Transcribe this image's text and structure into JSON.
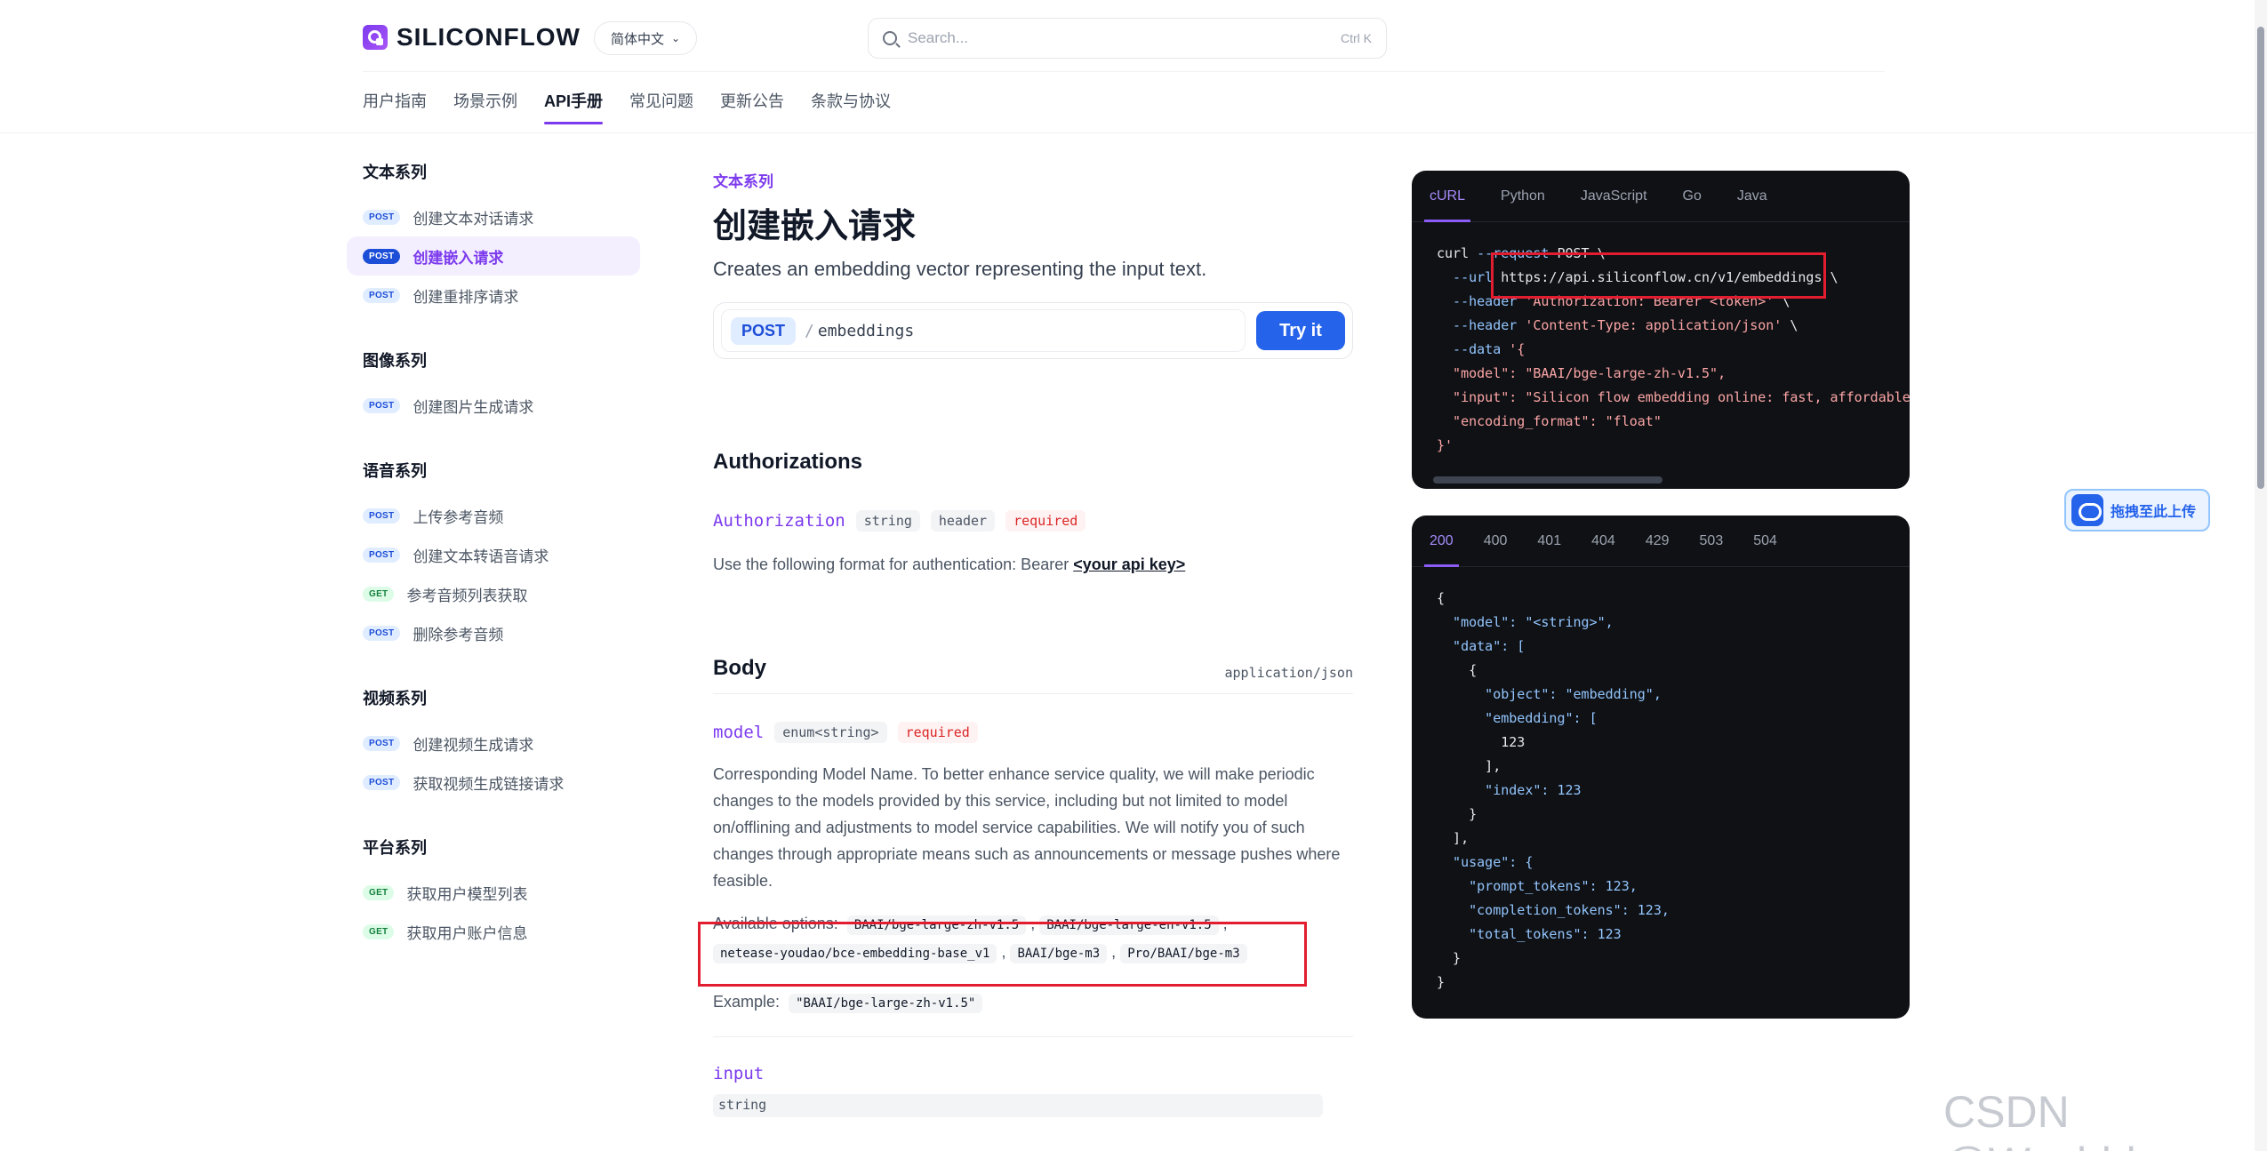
{
  "header": {
    "logo_text": "SILICONFLOW",
    "language": "简体中文",
    "search_placeholder": "Search...",
    "search_shortcut": "Ctrl K",
    "nav": [
      {
        "label": "用户指南"
      },
      {
        "label": "场景示例"
      },
      {
        "label": "API手册"
      },
      {
        "label": "常见问题"
      },
      {
        "label": "更新公告"
      },
      {
        "label": "条款与协议"
      }
    ]
  },
  "sidebar": {
    "groups": [
      {
        "title": "文本系列",
        "items": [
          {
            "method": "POST",
            "label": "创建文本对话请求"
          },
          {
            "method": "POST",
            "label": "创建嵌入请求"
          },
          {
            "method": "POST",
            "label": "创建重排序请求"
          }
        ]
      },
      {
        "title": "图像系列",
        "items": [
          {
            "method": "POST",
            "label": "创建图片生成请求"
          }
        ]
      },
      {
        "title": "语音系列",
        "items": [
          {
            "method": "POST",
            "label": "上传参考音频"
          },
          {
            "method": "POST",
            "label": "创建文本转语音请求"
          },
          {
            "method": "GET",
            "label": "参考音频列表获取"
          },
          {
            "method": "POST",
            "label": "删除参考音频"
          }
        ]
      },
      {
        "title": "视频系列",
        "items": [
          {
            "method": "POST",
            "label": "创建视频生成请求"
          },
          {
            "method": "POST",
            "label": "获取视频生成链接请求"
          }
        ]
      },
      {
        "title": "平台系列",
        "items": [
          {
            "method": "GET",
            "label": "获取用户模型列表"
          },
          {
            "method": "GET",
            "label": "获取用户账户信息"
          }
        ]
      }
    ]
  },
  "main": {
    "eyebrow": "文本系列",
    "title": "创建嵌入请求",
    "subtitle": "Creates an embedding vector representing the input text.",
    "method": "POST",
    "slash": "/",
    "path": "embeddings",
    "try_label": "Try it",
    "auth": {
      "title": "Authorizations",
      "param": "Authorization",
      "type": "string",
      "location": "header",
      "required": "required",
      "desc_prefix": "Use the following format for authentication: Bearer ",
      "desc_key": "<your api key>"
    },
    "body": {
      "title": "Body",
      "content_type": "application/json",
      "model_param": "model",
      "model_type": "enum<string>",
      "required": "required",
      "model_desc": "Corresponding Model Name. To better enhance service quality, we will make periodic changes to the models provided by this service, including but not limited to model on/offlining and adjustments to model service capabilities. We will notify you of such changes through appropriate means such as announcements or message pushes where feasible.",
      "options_label": "Available options:",
      "options": [
        "BAAI/bge-large-zh-v1.5",
        "BAAI/bge-large-en-v1.5",
        "netease-youdao/bce-embedding-base_v1",
        "BAAI/bge-m3",
        "Pro/BAAI/bge-m3"
      ],
      "example_label": "Example:",
      "example_value": "\"BAAI/bge-large-zh-v1.5\"",
      "input_param": "input",
      "input_type": "string"
    }
  },
  "request_panel": {
    "tabs": [
      "cURL",
      "Python",
      "JavaScript",
      "Go",
      "Java"
    ],
    "lines": {
      "l1a": "curl ",
      "l1b": "--request ",
      "l1c": "POST ",
      "l1d": "\\",
      "l2a": "  --url ",
      "l2b": "https://api.siliconflow.cn/v1/embeddings",
      "l2c": " \\",
      "l3a": "  --header ",
      "l3b": "'Authorization: Bearer <token>'",
      "l3c": " \\",
      "l4a": "  --header ",
      "l4b": "'Content-Type: application/json'",
      "l4c": " \\",
      "l5a": "  --data ",
      "l5b": "'{",
      "l6": "  \"model\": \"BAAI/bge-large-zh-v1.5\",",
      "l7": "  \"input\": \"Silicon flow embedding online: fast, affordable",
      "l8": "  \"encoding_format\": \"float\"",
      "l9": "}'"
    }
  },
  "response_panel": {
    "tabs": [
      "200",
      "400",
      "401",
      "404",
      "429",
      "503",
      "504"
    ],
    "lines": [
      "{",
      "  \"model\": \"<string>\",",
      "  \"data\": [",
      "    {",
      "      \"object\": \"embedding\",",
      "      \"embedding\": [",
      "        123",
      "      ],",
      "      \"index\": 123",
      "    }",
      "  ],",
      "  \"usage\": {",
      "    \"prompt_tokens\": 123,",
      "    \"completion_tokens\": 123,",
      "    \"total_tokens\": 123",
      "  }",
      "}"
    ]
  },
  "upload_widget": {
    "label": "拖拽至此上传"
  },
  "watermark": "CSDN @Wuyhhh",
  "colors": {
    "accent": "#7c3aed",
    "primary": "#2563eb",
    "highlight": "#e11d2f",
    "code_bg": "#0f1115"
  }
}
